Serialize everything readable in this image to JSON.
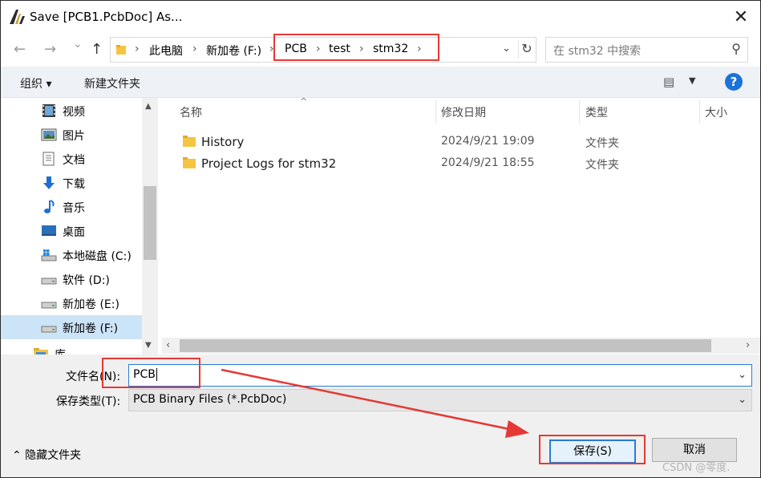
{
  "window": {
    "title": "Save [PCB1.PcbDoc] As...",
    "close_glyph": "✕"
  },
  "navigation": {
    "back_glyph": "←",
    "forward_glyph": "→",
    "recent_glyph": "⌄",
    "up_glyph": "↑",
    "breadcrumb": {
      "sep": "›",
      "segments": [
        "此电脑",
        "新加卷 (F:)",
        "PCB",
        "test",
        "stm32"
      ]
    },
    "dropdown_glyph": "⌄",
    "refresh_glyph": "↻",
    "search_placeholder": "在 stm32 中搜索",
    "search_glyph": "⚲"
  },
  "toolbar": {
    "organize_label": "组织 ▾",
    "new_folder_label": "新建文件夹",
    "view_glyph": "▤",
    "view_dropdown_glyph": "▼",
    "help_glyph": "?"
  },
  "sidebar": {
    "scroll_up": "▲",
    "scroll_down": "▼",
    "items": [
      {
        "label": "视频",
        "icon": "video-icon"
      },
      {
        "label": "图片",
        "icon": "pictures-icon"
      },
      {
        "label": "文档",
        "icon": "documents-icon"
      },
      {
        "label": "下载",
        "icon": "downloads-icon"
      },
      {
        "label": "音乐",
        "icon": "music-icon"
      },
      {
        "label": "桌面",
        "icon": "desktop-icon"
      },
      {
        "label": "本地磁盘 (C:)",
        "icon": "windows-drive-icon"
      },
      {
        "label": "软件 (D:)",
        "icon": "drive-icon"
      },
      {
        "label": "新加卷 (E:)",
        "icon": "drive-icon"
      },
      {
        "label": "新加卷 (F:)",
        "icon": "drive-icon",
        "selected": true
      },
      {
        "label": "库",
        "icon": "library-icon"
      }
    ]
  },
  "file_list": {
    "sort_glyph": "^",
    "columns": [
      "名称",
      "修改日期",
      "类型",
      "大小"
    ],
    "rows": [
      {
        "name": "History",
        "date": "2024/9/21 19:09",
        "type": "文件夹"
      },
      {
        "name": "Project Logs for stm32",
        "date": "2024/9/21 18:55",
        "type": "文件夹"
      }
    ],
    "scroll_left": "‹",
    "scroll_right": "›"
  },
  "form": {
    "filename_label": "文件名(N):",
    "filename_value": "PCB",
    "filetype_label": "保存类型(T):",
    "filetype_value": "PCB Binary Files (*.PcbDoc)",
    "dropdown_glyph": "⌄"
  },
  "footer": {
    "hide_folders_label": "⌃  隐藏文件夹",
    "save_label": "保存(S)",
    "cancel_label": "取消"
  },
  "watermark": "CSDN @零度.",
  "colors": {
    "accent": "#2a7bd3",
    "selection": "#cce4f7",
    "annotation": "#e53935",
    "folder": "#f5c542"
  }
}
